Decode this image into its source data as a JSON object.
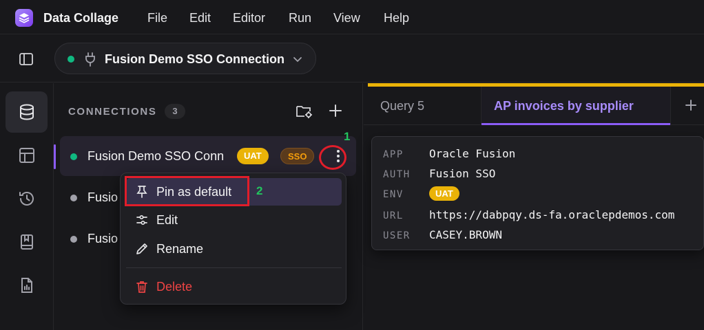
{
  "app": {
    "title": "Data Collage"
  },
  "menu": [
    "File",
    "Edit",
    "Editor",
    "Run",
    "View",
    "Help"
  ],
  "toolbar": {
    "connection_name": "Fusion Demo SSO Connection",
    "status_color": "#10b981"
  },
  "rail": {
    "items": [
      "database-icon",
      "table-icon",
      "history-icon",
      "notebook-icon",
      "report-icon"
    ]
  },
  "connections": {
    "header": "CONNECTIONS",
    "count": "3",
    "items": [
      {
        "label": "Fusion Demo SSO Conn",
        "status_color": "#10b981",
        "badges": [
          "UAT",
          "SSO"
        ]
      },
      {
        "label": "Fusio",
        "status_color": "#a1a1aa"
      },
      {
        "label": "Fusio",
        "status_color": "#a1a1aa"
      }
    ]
  },
  "context_menu": {
    "items": [
      {
        "label": "Pin as default",
        "icon": "pin-icon"
      },
      {
        "label": "Edit",
        "icon": "sliders-icon"
      },
      {
        "label": "Rename",
        "icon": "pencil-icon"
      },
      {
        "label": "Delete",
        "icon": "trash-icon",
        "color": "#ef4444"
      }
    ]
  },
  "annotations": {
    "step1": "1",
    "step2": "2"
  },
  "tabs": [
    {
      "label": "Query 5"
    },
    {
      "label": "AP invoices by supplier",
      "active": true
    }
  ],
  "info": {
    "rows": [
      {
        "key": "APP",
        "value": "Oracle Fusion"
      },
      {
        "key": "AUTH",
        "value": "Fusion SSO"
      },
      {
        "key": "ENV",
        "value": "UAT"
      },
      {
        "key": "URL",
        "value": "https://dabpqy.ds-fa.oraclepdemos.com"
      },
      {
        "key": "USER",
        "value": "CASEY.BROWN"
      }
    ]
  },
  "colors": {
    "accent": "#8b5cf6",
    "uat": "#eab308",
    "danger": "#ef4444",
    "highlight": "#e11d2a",
    "step": "#22c55e"
  }
}
